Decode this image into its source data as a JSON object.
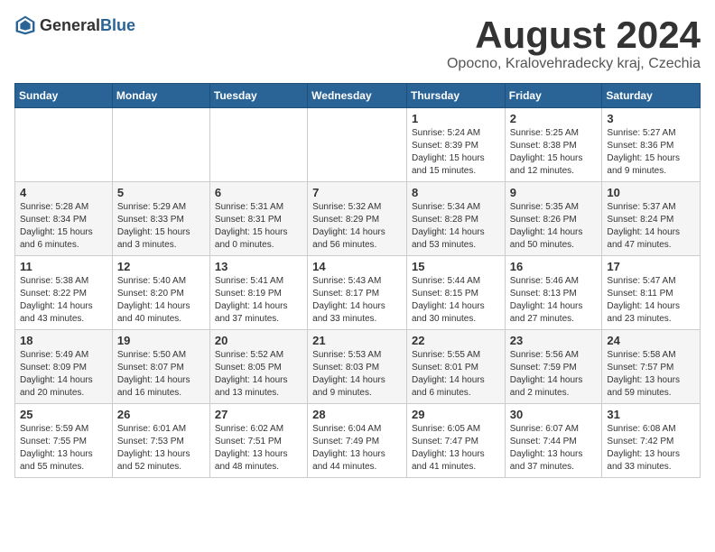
{
  "header": {
    "logo_general": "General",
    "logo_blue": "Blue",
    "title": "August 2024",
    "subtitle": "Opocno, Kralovehradecky kraj, Czechia"
  },
  "weekdays": [
    "Sunday",
    "Monday",
    "Tuesday",
    "Wednesday",
    "Thursday",
    "Friday",
    "Saturday"
  ],
  "weeks": [
    {
      "days": [
        {
          "num": "",
          "info": ""
        },
        {
          "num": "",
          "info": ""
        },
        {
          "num": "",
          "info": ""
        },
        {
          "num": "",
          "info": ""
        },
        {
          "num": "1",
          "info": "Sunrise: 5:24 AM\nSunset: 8:39 PM\nDaylight: 15 hours\nand 15 minutes."
        },
        {
          "num": "2",
          "info": "Sunrise: 5:25 AM\nSunset: 8:38 PM\nDaylight: 15 hours\nand 12 minutes."
        },
        {
          "num": "3",
          "info": "Sunrise: 5:27 AM\nSunset: 8:36 PM\nDaylight: 15 hours\nand 9 minutes."
        }
      ]
    },
    {
      "days": [
        {
          "num": "4",
          "info": "Sunrise: 5:28 AM\nSunset: 8:34 PM\nDaylight: 15 hours\nand 6 minutes."
        },
        {
          "num": "5",
          "info": "Sunrise: 5:29 AM\nSunset: 8:33 PM\nDaylight: 15 hours\nand 3 minutes."
        },
        {
          "num": "6",
          "info": "Sunrise: 5:31 AM\nSunset: 8:31 PM\nDaylight: 15 hours\nand 0 minutes."
        },
        {
          "num": "7",
          "info": "Sunrise: 5:32 AM\nSunset: 8:29 PM\nDaylight: 14 hours\nand 56 minutes."
        },
        {
          "num": "8",
          "info": "Sunrise: 5:34 AM\nSunset: 8:28 PM\nDaylight: 14 hours\nand 53 minutes."
        },
        {
          "num": "9",
          "info": "Sunrise: 5:35 AM\nSunset: 8:26 PM\nDaylight: 14 hours\nand 50 minutes."
        },
        {
          "num": "10",
          "info": "Sunrise: 5:37 AM\nSunset: 8:24 PM\nDaylight: 14 hours\nand 47 minutes."
        }
      ]
    },
    {
      "days": [
        {
          "num": "11",
          "info": "Sunrise: 5:38 AM\nSunset: 8:22 PM\nDaylight: 14 hours\nand 43 minutes."
        },
        {
          "num": "12",
          "info": "Sunrise: 5:40 AM\nSunset: 8:20 PM\nDaylight: 14 hours\nand 40 minutes."
        },
        {
          "num": "13",
          "info": "Sunrise: 5:41 AM\nSunset: 8:19 PM\nDaylight: 14 hours\nand 37 minutes."
        },
        {
          "num": "14",
          "info": "Sunrise: 5:43 AM\nSunset: 8:17 PM\nDaylight: 14 hours\nand 33 minutes."
        },
        {
          "num": "15",
          "info": "Sunrise: 5:44 AM\nSunset: 8:15 PM\nDaylight: 14 hours\nand 30 minutes."
        },
        {
          "num": "16",
          "info": "Sunrise: 5:46 AM\nSunset: 8:13 PM\nDaylight: 14 hours\nand 27 minutes."
        },
        {
          "num": "17",
          "info": "Sunrise: 5:47 AM\nSunset: 8:11 PM\nDaylight: 14 hours\nand 23 minutes."
        }
      ]
    },
    {
      "days": [
        {
          "num": "18",
          "info": "Sunrise: 5:49 AM\nSunset: 8:09 PM\nDaylight: 14 hours\nand 20 minutes."
        },
        {
          "num": "19",
          "info": "Sunrise: 5:50 AM\nSunset: 8:07 PM\nDaylight: 14 hours\nand 16 minutes."
        },
        {
          "num": "20",
          "info": "Sunrise: 5:52 AM\nSunset: 8:05 PM\nDaylight: 14 hours\nand 13 minutes."
        },
        {
          "num": "21",
          "info": "Sunrise: 5:53 AM\nSunset: 8:03 PM\nDaylight: 14 hours\nand 9 minutes."
        },
        {
          "num": "22",
          "info": "Sunrise: 5:55 AM\nSunset: 8:01 PM\nDaylight: 14 hours\nand 6 minutes."
        },
        {
          "num": "23",
          "info": "Sunrise: 5:56 AM\nSunset: 7:59 PM\nDaylight: 14 hours\nand 2 minutes."
        },
        {
          "num": "24",
          "info": "Sunrise: 5:58 AM\nSunset: 7:57 PM\nDaylight: 13 hours\nand 59 minutes."
        }
      ]
    },
    {
      "days": [
        {
          "num": "25",
          "info": "Sunrise: 5:59 AM\nSunset: 7:55 PM\nDaylight: 13 hours\nand 55 minutes."
        },
        {
          "num": "26",
          "info": "Sunrise: 6:01 AM\nSunset: 7:53 PM\nDaylight: 13 hours\nand 52 minutes."
        },
        {
          "num": "27",
          "info": "Sunrise: 6:02 AM\nSunset: 7:51 PM\nDaylight: 13 hours\nand 48 minutes."
        },
        {
          "num": "28",
          "info": "Sunrise: 6:04 AM\nSunset: 7:49 PM\nDaylight: 13 hours\nand 44 minutes."
        },
        {
          "num": "29",
          "info": "Sunrise: 6:05 AM\nSunset: 7:47 PM\nDaylight: 13 hours\nand 41 minutes."
        },
        {
          "num": "30",
          "info": "Sunrise: 6:07 AM\nSunset: 7:44 PM\nDaylight: 13 hours\nand 37 minutes."
        },
        {
          "num": "31",
          "info": "Sunrise: 6:08 AM\nSunset: 7:42 PM\nDaylight: 13 hours\nand 33 minutes."
        }
      ]
    }
  ]
}
